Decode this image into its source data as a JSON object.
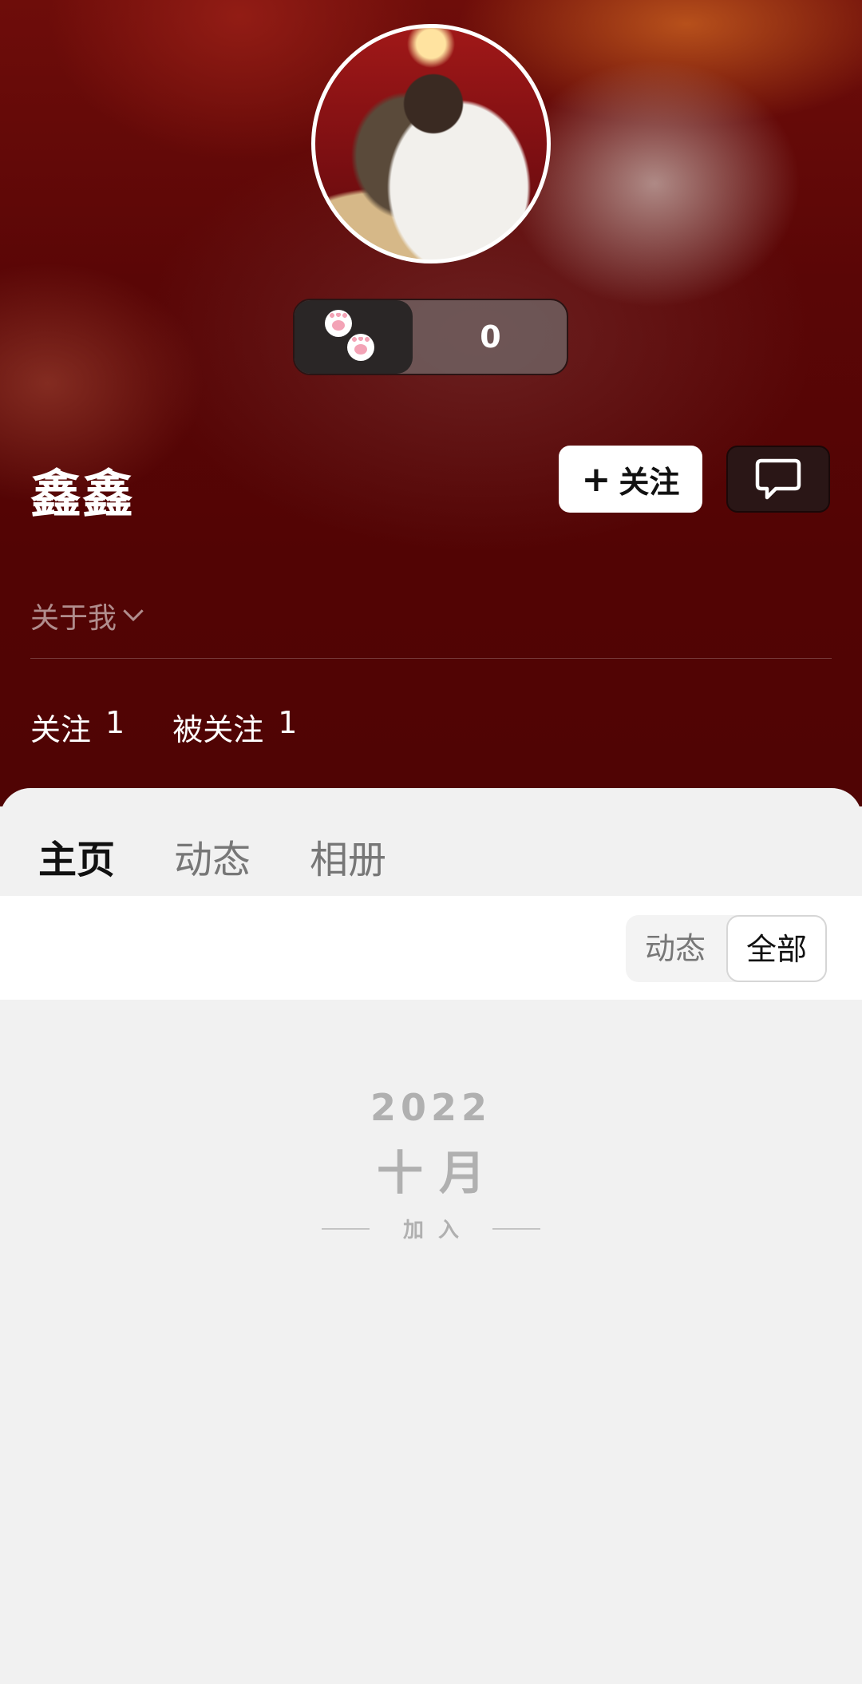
{
  "profile": {
    "username": "鑫鑫",
    "paw_count": "0",
    "about_label": "关于我"
  },
  "actions": {
    "follow_label": "关注",
    "follow_icon": "plus-icon",
    "message_icon": "chat-bubble-icon"
  },
  "stats": {
    "following_label": "关注",
    "following_count": "1",
    "followers_label": "被关注",
    "followers_count": "1"
  },
  "tabs": [
    {
      "label": "主页",
      "active": true
    },
    {
      "label": "动态",
      "active": false
    },
    {
      "label": "相册",
      "active": false
    }
  ],
  "filter": {
    "option_a": "动态",
    "option_b": "全部",
    "selected": "全部"
  },
  "timeline": {
    "year": "2022",
    "month": "十月",
    "event": "加入"
  },
  "colors": {
    "hero_bg": "#520404",
    "accent": "#111111",
    "muted": "#b0b0b0"
  }
}
